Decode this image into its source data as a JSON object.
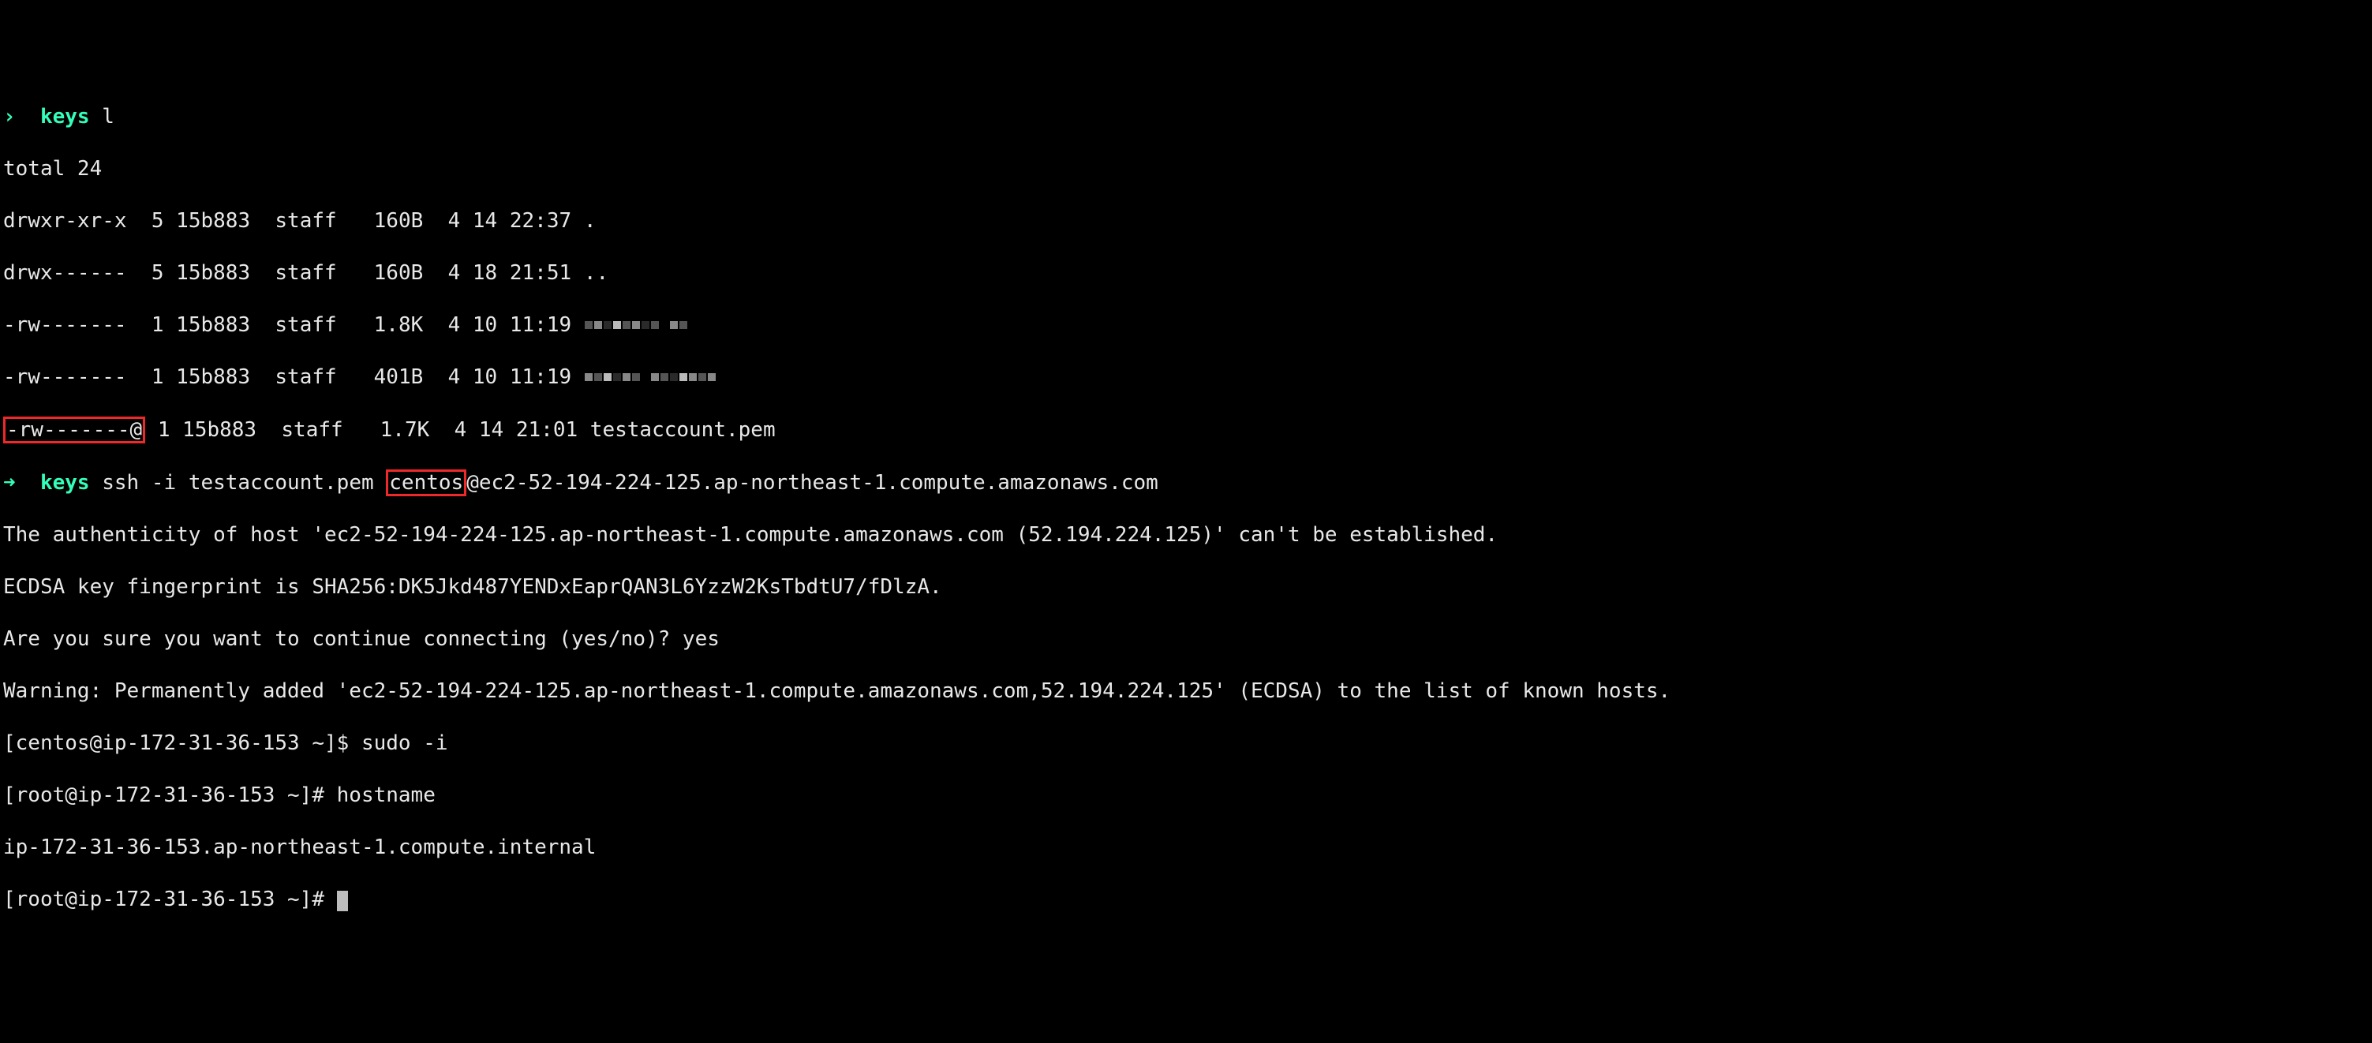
{
  "lines": {
    "l0_arrow": "›",
    "l0_keys": "keys",
    "l0_rest": " l",
    "l1": "total 24",
    "ls": [
      {
        "perm": "drwxr-xr-x",
        "links": "5",
        "owner": "15b883",
        "group": "staff",
        "size": "160B",
        "m": "4",
        "d": "14",
        "time": "22:37",
        "name": "."
      },
      {
        "perm": "drwx------",
        "links": "5",
        "owner": "15b883",
        "group": "staff",
        "size": "160B",
        "m": "4",
        "d": "18",
        "time": "21:51",
        "name": ".."
      },
      {
        "perm": "-rw-------",
        "links": "1",
        "owner": "15b883",
        "group": "staff",
        "size": "1.8K",
        "m": "4",
        "d": "10",
        "time": "11:19",
        "name": ""
      },
      {
        "perm": "-rw-------",
        "links": "1",
        "owner": "15b883",
        "group": "staff",
        "size": "401B",
        "m": "4",
        "d": "10",
        "time": "11:19",
        "name": ""
      },
      {
        "perm": "-rw-------@",
        "links": "1",
        "owner": "15b883",
        "group": "staff",
        "size": "1.7K",
        "m": "4",
        "d": "14",
        "time": "21:01",
        "name": "testaccount.pem"
      }
    ],
    "ssh": {
      "arrow": "➜",
      "keys": "keys",
      "cmd_before_user": " ssh -i testaccount.pem ",
      "user": "centos",
      "cmd_after_user": "@ec2-52-194-224-125.ap-northeast-1.compute.amazonaws.com"
    },
    "auth1": "The authenticity of host 'ec2-52-194-224-125.ap-northeast-1.compute.amazonaws.com (52.194.224.125)' can't be established.",
    "auth2": "ECDSA key fingerprint is SHA256:DK5Jkd487YENDxEaprQAN3L6YzzW2KsTbdtU7/fDlzA.",
    "auth3": "Are you sure you want to continue connecting (yes/no)? yes",
    "auth4": "Warning: Permanently added 'ec2-52-194-224-125.ap-northeast-1.compute.amazonaws.com,52.194.224.125' (ECDSA) to the list of known hosts.",
    "centos_prompt": "[centos@ip-172-31-36-153 ~]$ ",
    "centos_cmd": "sudo -i",
    "root_prompt1": "[root@ip-172-31-36-153 ~]# ",
    "root_cmd1": "hostname",
    "hostname_out": "ip-172-31-36-153.ap-northeast-1.compute.internal",
    "root_prompt2": "[root@ip-172-31-36-153 ~]# "
  }
}
